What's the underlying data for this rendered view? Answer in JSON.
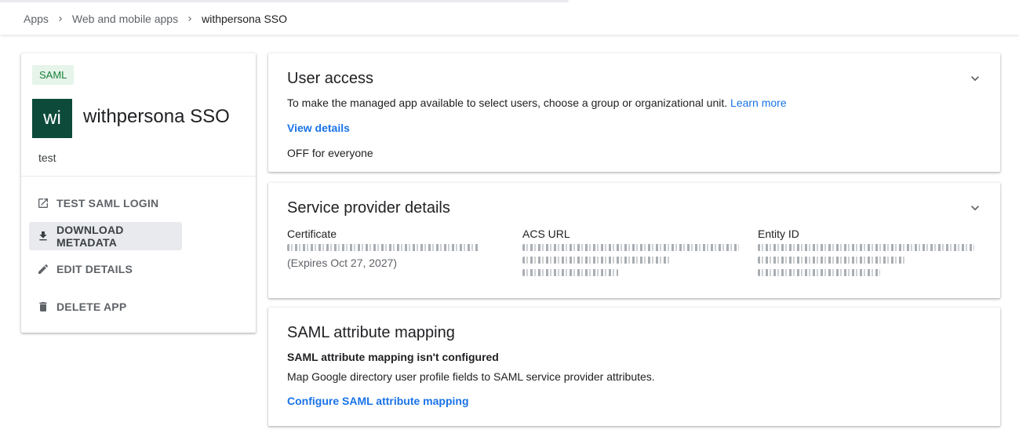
{
  "breadcrumb": {
    "items": [
      "Apps",
      "Web and mobile apps"
    ],
    "current": "withpersona SSO"
  },
  "app": {
    "badge": "SAML",
    "logo_text": "wi",
    "name": "withpersona SSO",
    "description": "test",
    "logo_color": "#0d4a3a"
  },
  "actions": [
    {
      "label": "TEST SAML LOGIN",
      "icon": "open-in-new-icon"
    },
    {
      "label": "DOWNLOAD METADATA",
      "icon": "download-icon"
    },
    {
      "label": "EDIT DETAILS",
      "icon": "pencil-icon"
    },
    {
      "label": "DELETE APP",
      "icon": "trash-icon"
    }
  ],
  "user_access": {
    "title": "User access",
    "description": "To make the managed app available to select users, choose a group or organizational unit.",
    "learn_more": "Learn more",
    "view_details": "View details",
    "status": "OFF for everyone"
  },
  "service_provider": {
    "title": "Service provider details",
    "certificate_label": "Certificate",
    "certificate_expires": "(Expires Oct 27, 2027)",
    "acs_label": "ACS URL",
    "entity_label": "Entity ID"
  },
  "saml_mapping": {
    "title": "SAML attribute mapping",
    "status": "SAML attribute mapping isn't configured",
    "description": "Map Google directory user profile fields to SAML service provider attributes.",
    "configure": "Configure SAML attribute mapping"
  },
  "colors": {
    "link": "#1a73e8",
    "badge_bg": "#e6f4ea",
    "badge_text": "#188038"
  }
}
